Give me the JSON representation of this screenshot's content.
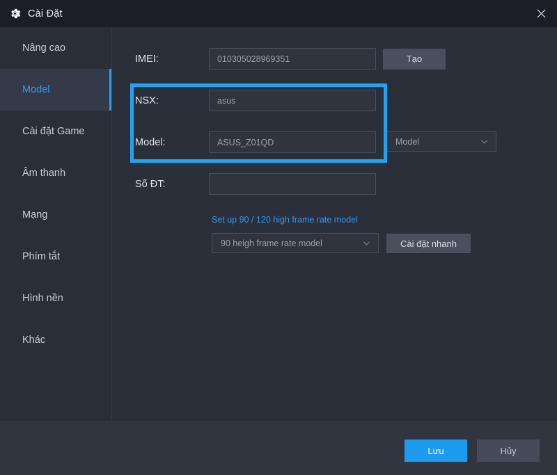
{
  "window": {
    "title": "Cài Đặt",
    "gear_icon": "gear-icon",
    "close_icon": "close-icon"
  },
  "sidebar": {
    "items": [
      {
        "label": "Nâng cao",
        "active": false
      },
      {
        "label": "Model",
        "active": true
      },
      {
        "label": "Cài đặt Game",
        "active": false
      },
      {
        "label": "Âm thanh",
        "active": false
      },
      {
        "label": "Mạng",
        "active": false
      },
      {
        "label": "Phím tắt",
        "active": false
      },
      {
        "label": "Hình nền",
        "active": false
      },
      {
        "label": "Khác",
        "active": false
      }
    ]
  },
  "form": {
    "imei": {
      "label": "IMEI:",
      "value": "010305028969351",
      "button_label": "Tạo"
    },
    "nsx": {
      "label": "NSX:",
      "value": "asus"
    },
    "model": {
      "label": "Model:",
      "value": "ASUS_Z01QD",
      "dropdown_value": "Model",
      "dropdown_icon": "chevron-down-icon"
    },
    "phone": {
      "label": "Số ĐT:",
      "value": "",
      "placeholder": ""
    },
    "frame_rate": {
      "link_text": "Set up 90 / 120 high frame rate model",
      "dropdown_value": "90 heigh frame rate model",
      "dropdown_icon": "chevron-down-icon",
      "button_label": "Cài đặt nhanh"
    }
  },
  "footer": {
    "save_label": "Lưu",
    "cancel_label": "Hủy"
  },
  "colors": {
    "accent": "#1d9bf0",
    "highlight_box": "#22a3f2",
    "window_bg": "#2b2f3a",
    "titlebar_bg": "#1b1e27",
    "sidebar_bg": "#2a2e38",
    "footer_bg": "#31353f"
  }
}
